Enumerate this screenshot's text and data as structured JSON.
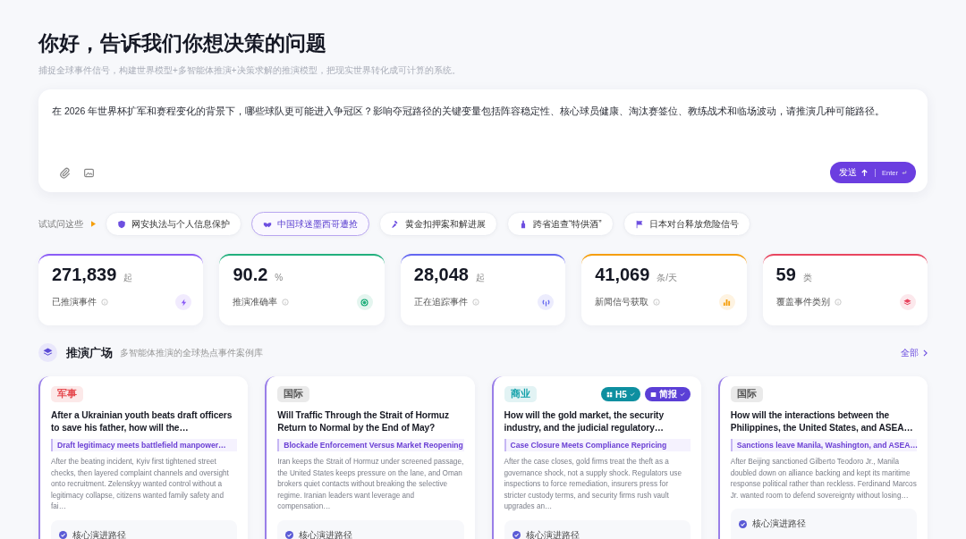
{
  "header": {
    "title": "你好，告诉我们你想决策的问题",
    "subtitle": "捕捉全球事件信号，构建世界模型+多智能体推演+决策求解的推演模型，把现实世界转化成可计算的系统。"
  },
  "composer": {
    "value": "在 2026 年世界杯扩军和赛程变化的背景下，哪些球队更可能进入争冠区？影响夺冠路径的关键变量包括阵容稳定性、核心球员健康、淘汰赛签位、教练战术和临场波动，请推演几种可能路径。",
    "send_label": "发送",
    "send_hint": "Enter"
  },
  "suggestions": {
    "label": "试试问这些",
    "items": [
      {
        "kind": "shield",
        "label": "网安执法与个人信息保护",
        "selected": false
      },
      {
        "kind": "handshake",
        "label": "中国球迷墨西哥遭抢",
        "selected": true
      },
      {
        "kind": "gavel",
        "label": "黄金扣押案和解进展",
        "selected": false
      },
      {
        "kind": "bottle",
        "label": "跨省追查“特供酒”",
        "selected": false
      },
      {
        "kind": "flag",
        "label": "日本对台释放危险信号",
        "selected": false
      }
    ]
  },
  "stats": [
    {
      "value": "271,839",
      "unit": "起",
      "label": "已推演事件",
      "kind": "bolt",
      "color": "#8b5cf6"
    },
    {
      "value": "90.2",
      "unit": "%",
      "label": "推演准确率",
      "kind": "target",
      "color": "#22b07d"
    },
    {
      "value": "28,048",
      "unit": "起",
      "label": "正在追踪事件",
      "kind": "signal",
      "color": "#6366f1"
    },
    {
      "value": "41,069",
      "unit": "条/天",
      "label": "新闻信号获取",
      "kind": "bars",
      "color": "#f59e0b"
    },
    {
      "value": "59",
      "unit": "类",
      "label": "覆盖事件类别",
      "kind": "layers",
      "color": "#e8455f"
    }
  ],
  "plaza": {
    "title": "推演广场",
    "subtitle": "多智能体推演的全球热点事件案例库",
    "more": "全部",
    "cards": [
      {
        "tag": "军事",
        "color": "#e5484d",
        "title": "After a Ukrainian youth beats draft officers to save his father, how will the…",
        "headline": "Draft legitimacy meets battlefield manpower…",
        "summary": "After the beating incident, Kyiv first tightened street checks, then layered complaint channels and oversight onto recruitment. Zelenskyy wanted control without a legitimacy collapse, citizens wanted family safety and fai…",
        "path_label": "核心演进路径"
      },
      {
        "tag": "国际",
        "color": "#555555",
        "title": "Will Traffic Through the Strait of Hormuz Return to Normal by the End of May?",
        "headline": "Blockade Enforcement Versus Market Reopening",
        "summary": "Iran keeps the Strait of Hormuz under screened passage, the United States keeps pressure on the lane, and Oman brokers quiet contacts without breaking the selective regime. Iranian leaders want leverage and compensation…",
        "path_label": "核心演进路径"
      },
      {
        "tag": "商业",
        "color": "#0e9fa8",
        "badges": [
          {
            "kind": "grid",
            "label": "H5",
            "color": "#0e8fa0"
          },
          {
            "kind": "doc",
            "label": "简报",
            "color": "#5b3fd6"
          }
        ],
        "title": "How will the gold market, the security industry, and the judicial regulatory…",
        "headline": "Case Closure Meets Compliance Repricing",
        "summary": "After the case closes, gold firms treat the theft as a governance shock, not a supply shock. Regulators use inspections to force remediation, insurers press for stricter custody terms, and security firms rush vault upgrades an…",
        "path_label": "核心演进路径"
      },
      {
        "tag": "国际",
        "color": "#555555",
        "title": "How will the interactions between the Philippines, the United States, and ASEA…",
        "headline": "Sanctions leave Manila, Washington, and ASEA…",
        "summary": "After Beijing sanctioned Gilberto Teodoro Jr., Manila doubled down on alliance backing and kept its maritime response political rather than reckless. Ferdinand Marcos Jr. wanted room to defend sovereignty without losing…",
        "path_label": "核心演进路径"
      }
    ]
  }
}
